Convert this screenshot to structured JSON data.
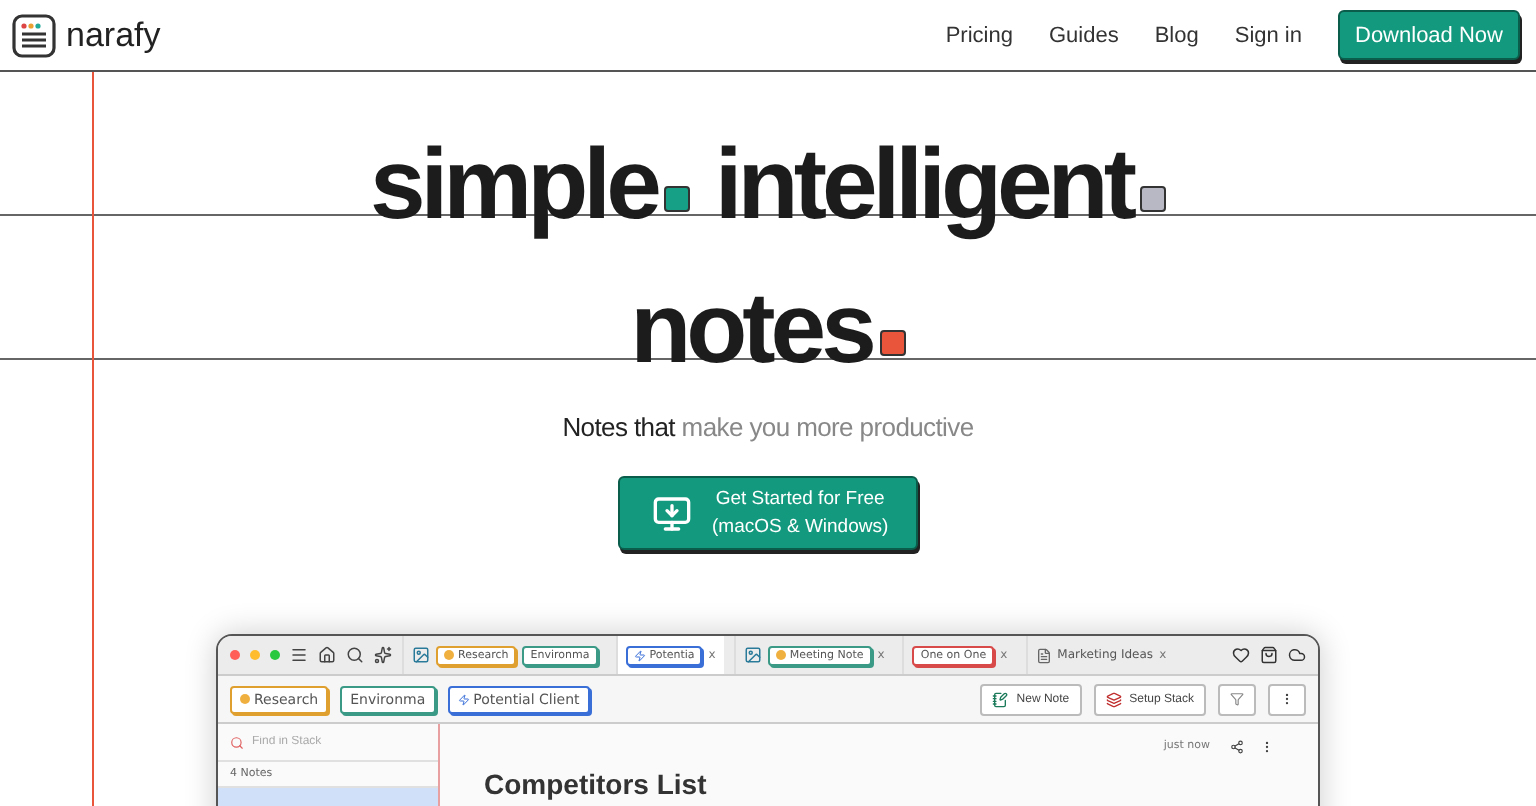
{
  "nav": {
    "brand": "narafy",
    "links": [
      {
        "label": "Pricing"
      },
      {
        "label": "Guides"
      },
      {
        "label": "Blog"
      },
      {
        "label": "Sign in"
      }
    ],
    "cta": "Download Now"
  },
  "headline": [
    {
      "words": [
        {
          "text": "simple",
          "color": "#16a085"
        },
        {
          "text": "intelligent",
          "color": "#b8b8c4"
        }
      ]
    },
    {
      "words": [
        {
          "text": "notes",
          "color": "#e8553a"
        }
      ]
    }
  ],
  "subtitle": {
    "lead": "Notes that",
    "rest": "make you more productive"
  },
  "start_button": {
    "line_1": "Get Started for Free",
    "line_2": "(macOS & Windows)"
  },
  "app": {
    "tabs": [
      {
        "kind": "image",
        "selected": false,
        "chips": [
          {
            "label": "Research",
            "color": "#e0a030",
            "kind": "dot"
          },
          {
            "label": "Environma",
            "color": "#3a9a86",
            "kind": "plain"
          }
        ]
      },
      {
        "kind": "plain",
        "selected": true,
        "close": "x",
        "chips": [
          {
            "label": "Potentia",
            "color": "#3a6fd8",
            "kind": "bolt"
          }
        ]
      },
      {
        "kind": "image",
        "selected": false,
        "close": "x",
        "chips": [
          {
            "label": "Meeting Note",
            "color": "#3a9a86",
            "kind": "dot"
          }
        ]
      },
      {
        "kind": "plain",
        "selected": false,
        "close": "x",
        "chips": [
          {
            "label": "One on One",
            "color": "#d84a4a",
            "kind": "plain"
          }
        ]
      },
      {
        "kind": "doc",
        "selected": false,
        "close": "x",
        "title": "Marketing Ideas"
      }
    ],
    "stack_chips": [
      {
        "label": "Research",
        "color": "#e0a030",
        "kind": "dot"
      },
      {
        "label": "Environma",
        "color": "#3a9a86",
        "kind": "plain"
      },
      {
        "label": "Potential Client",
        "color": "#3a6fd8",
        "kind": "bolt"
      }
    ],
    "actions": [
      {
        "label": "New Note",
        "kind": "note"
      },
      {
        "label": "Setup Stack",
        "kind": "stack"
      }
    ],
    "sidebar": {
      "placeholder": "Find in Stack",
      "count": "4 Notes"
    },
    "note": {
      "title": "Competitors List",
      "time": "just now"
    }
  }
}
